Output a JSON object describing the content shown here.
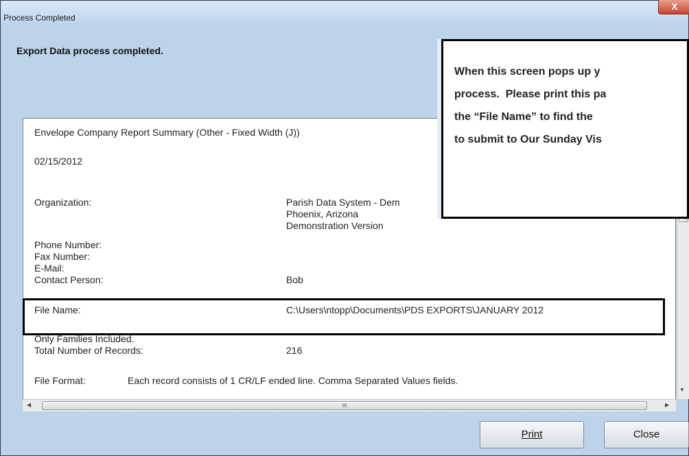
{
  "window": {
    "title": "Process Completed",
    "close_glyph": "X"
  },
  "heading": "Export Data process completed.",
  "report": {
    "title": "Envelope Company Report Summary (Other - Fixed Width (J))",
    "date": "02/15/2012",
    "organization_label": "Organization:",
    "organization_lines": [
      "Parish Data System - Dem",
      "Phoenix, Arizona",
      "Demonstration Version"
    ],
    "phone_label": "Phone Number:",
    "fax_label": "Fax Number:",
    "email_label": "E-Mail:",
    "contact_label": "Contact Person:",
    "contact_value": "Bob",
    "file_name_label": "File Name:",
    "file_name_value": "C:\\Users\\ntopp\\Documents\\PDS EXPORTS\\JANUARY 2012",
    "families_note": "Only Families Included.",
    "records_label": "Total Number of Records:",
    "records_value": "216",
    "format_label": "File Format:",
    "format_value": "Each record consists of 1 CR/LF ended line.  Comma Separated Values fields."
  },
  "buttons": {
    "print": "Print",
    "close": "Close"
  },
  "callout": {
    "lines": [
      "When this screen pops up y",
      "process.  Please print this pa",
      "the “File Name” to find the ",
      "to submit to Our Sunday Vis"
    ]
  },
  "scrollbar": {
    "h_grip": "III"
  }
}
